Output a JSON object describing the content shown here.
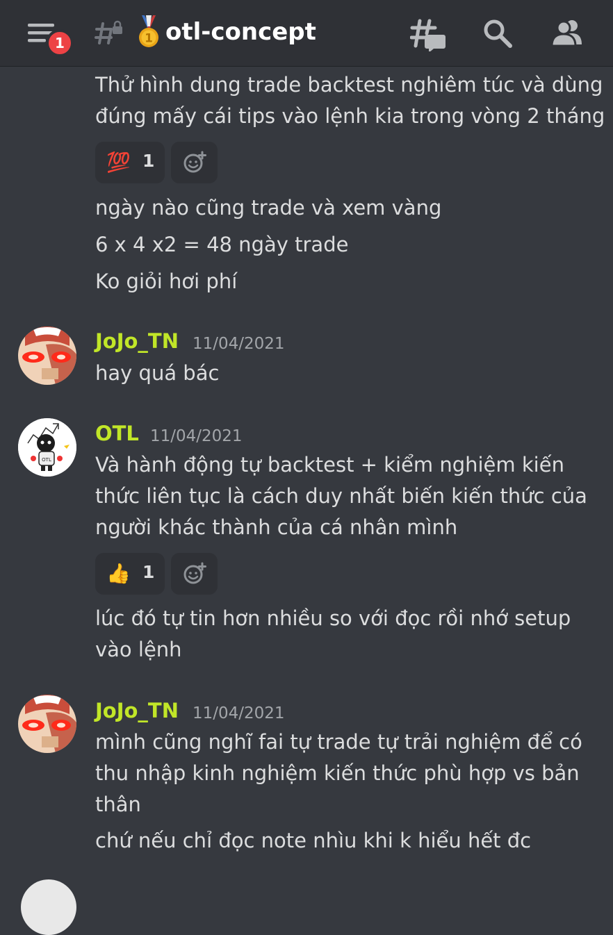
{
  "header": {
    "notification_count": "1",
    "channel_name": "otl-concept",
    "icons": [
      "hamburger-icon",
      "locked-channel-icon",
      "medal-icon",
      "threads-icon",
      "search-icon",
      "members-icon"
    ]
  },
  "colors": {
    "background": "#36393f",
    "header": "#2f3136",
    "username": "#c1e628",
    "badge": "#ed4245",
    "text": "#dcddde",
    "timestamp": "#a3a6aa"
  },
  "messages": {
    "m0": {
      "lines": [
        "Thử hình dung trade backtest nghiêm túc và dùng",
        "đúng mấy cái tips vào lệnh kia trong vòng 2 tháng"
      ],
      "reaction": {
        "emoji": "💯",
        "count": "1"
      }
    },
    "m1": {
      "text": "ngày nào cũng trade và xem vàng"
    },
    "m2": {
      "text": "6 x 4 x2 = 48 ngày trade"
    },
    "m3": {
      "text": "Ko giỏi hơi phí"
    },
    "m4": {
      "author": "JoJo_TN",
      "timestamp": "11/04/2021",
      "text": "hay quá bác"
    },
    "m5": {
      "author": "OTL",
      "timestamp": "11/04/2021",
      "lines": [
        "Và hành động tự backtest + kiểm nghiệm kiến",
        "thức liên tục là cách duy nhất biến kiến thức của",
        "người khác thành của cá nhân mình"
      ],
      "reaction": {
        "emoji": "👍",
        "count": "1"
      }
    },
    "m6": {
      "lines": [
        "lúc đó tự tin hơn nhiều so với đọc rồi nhớ setup",
        "vào lệnh"
      ]
    },
    "m7": {
      "author": "JoJo_TN",
      "timestamp": "11/04/2021",
      "lines": [
        "mình cũng nghĩ fai tự trade tự trải nghiệm để có",
        "thu nhập kinh nghiệm kiến thức phù hợp vs bản",
        "thân"
      ]
    },
    "m8": {
      "text": "chứ nếu chỉ đọc note nhìu khi k hiểu hết đc"
    }
  }
}
